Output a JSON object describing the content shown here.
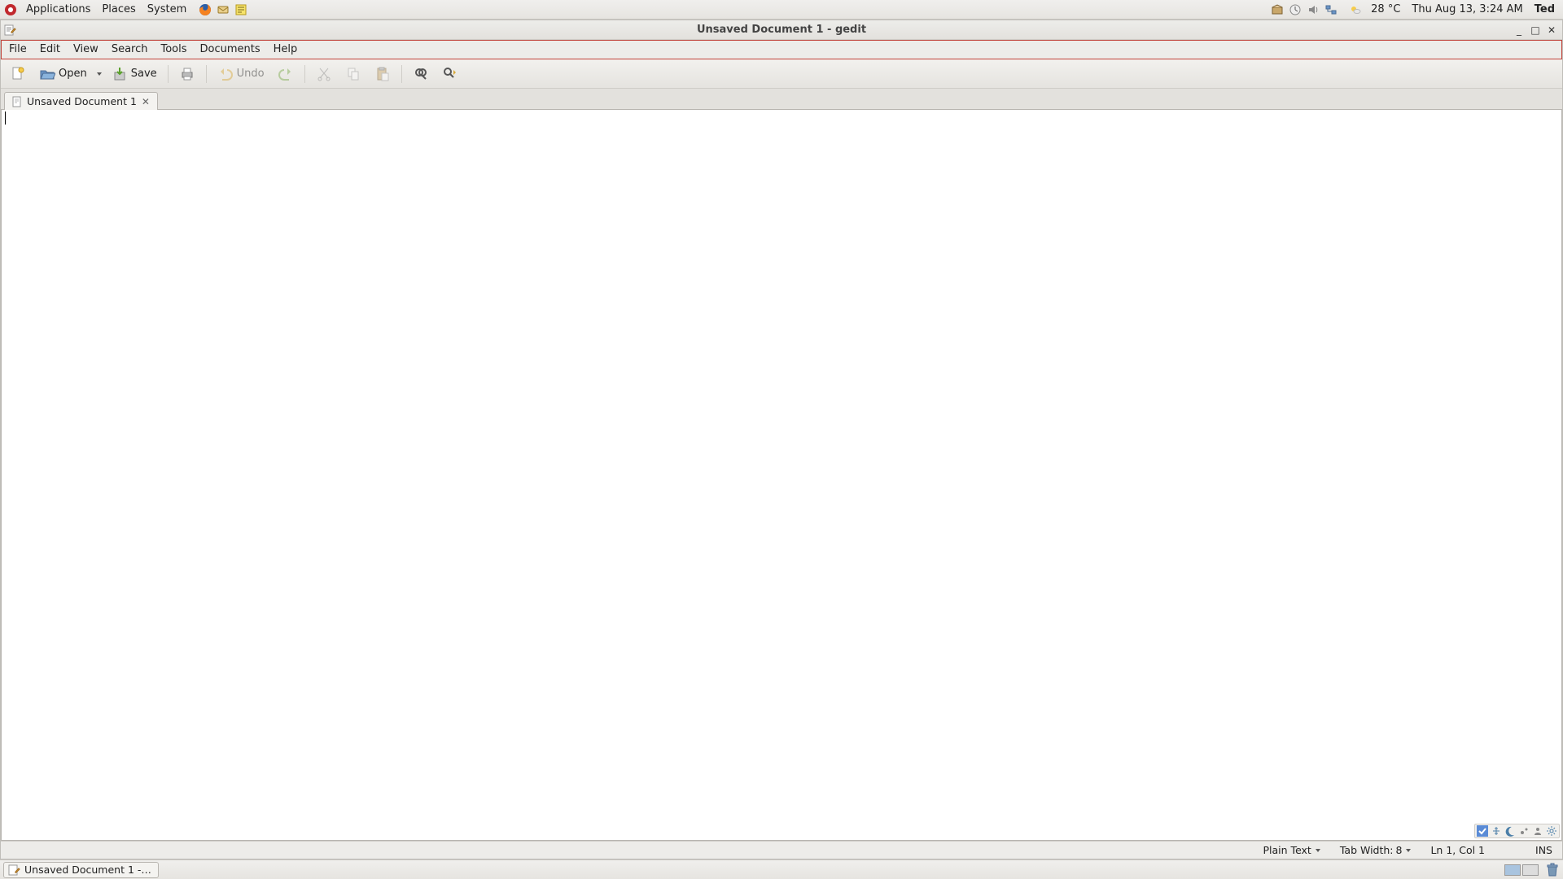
{
  "panel": {
    "menus": [
      "Applications",
      "Places",
      "System"
    ],
    "weather": {
      "temp": "28 °C"
    },
    "clock": "Thu Aug 13,  3:24 AM",
    "user": "Ted"
  },
  "window": {
    "title": "Unsaved Document 1 - gedit"
  },
  "menubar": [
    "File",
    "Edit",
    "View",
    "Search",
    "Tools",
    "Documents",
    "Help"
  ],
  "toolbar": {
    "open": "Open",
    "save": "Save",
    "undo": "Undo"
  },
  "tab": {
    "label": "Unsaved Document 1"
  },
  "status": {
    "syntax": "Plain Text",
    "tabwidth_label": "Tab Width:",
    "tabwidth_value": "8",
    "cursor": "Ln 1, Col 1",
    "mode": "INS"
  },
  "taskbar": {
    "active": "Unsaved Document 1 -…"
  }
}
